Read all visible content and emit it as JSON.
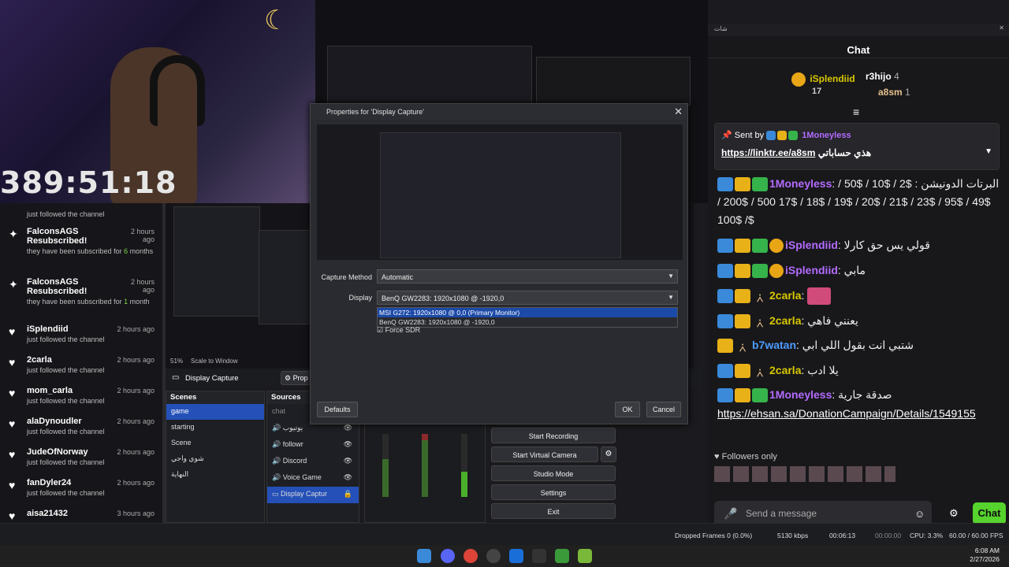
{
  "timer": "389:51:18",
  "events": [
    {
      "name": "",
      "desc": "just followed the channel",
      "time": "2 hours ago",
      "icon": "heart-icon"
    },
    {
      "name": "FalconsAGS Resubscribed!",
      "desc_pre": "they have been subscribed for ",
      "desc_hl": "6",
      "desc_post": " months",
      "time": "2 hours ago",
      "icon": "star-icon"
    },
    {
      "name": "FalconsAGS Resubscribed!",
      "desc_pre": "they have been subscribed for ",
      "desc_hl": "1",
      "desc_post": " month",
      "time": "2 hours ago",
      "icon": "star-icon"
    },
    {
      "name": "iSplendiid",
      "desc": "just followed the channel",
      "time": "2 hours ago",
      "icon": "heart-icon"
    },
    {
      "name": "2carla",
      "desc": "just followed the channel",
      "time": "2 hours ago",
      "icon": "heart-icon"
    },
    {
      "name": "mom_carla",
      "desc": "just followed the channel",
      "time": "2 hours ago",
      "icon": "heart-icon"
    },
    {
      "name": "alaDynoudler",
      "desc": "just followed the channel",
      "time": "2 hours ago",
      "icon": "heart-icon"
    },
    {
      "name": "JudeOfNorway",
      "desc": "just followed the channel",
      "time": "2 hours ago",
      "icon": "heart-icon"
    },
    {
      "name": "fanDyler24",
      "desc": "just followed the channel",
      "time": "2 hours ago",
      "icon": "heart-icon"
    },
    {
      "name": "aisa21432",
      "desc": "",
      "time": "3 hours ago",
      "icon": "heart-icon"
    }
  ],
  "dialog": {
    "title": "Properties for 'Display Capture'",
    "capture_method_label": "Capture Method",
    "capture_method_value": "Automatic",
    "display_label": "Display",
    "display_value": "BenQ GW2283: 1920x1080 @ -1920,0",
    "options": [
      "MSI G272: 1920x1080 @ 0,0 (Primary Monitor)",
      "BenQ GW2283: 1920x1080 @ -1920,0"
    ],
    "force_sdr": "Force SDR",
    "defaults": "Defaults",
    "ok": "OK",
    "cancel": "Cancel"
  },
  "obs": {
    "zoom": "51%",
    "scale": "Scale to Window",
    "source_name": "Display Capture",
    "properties": "Prop",
    "scenes_title": "Scenes",
    "scenes": [
      "game",
      "starting",
      "Scene",
      "شوي واجي",
      "النهاية"
    ],
    "sources_title": "Sources",
    "sources": [
      "chat",
      "يوتيوب",
      "followr",
      "Discord",
      "Voice Game",
      "Display Captur"
    ],
    "controls": [
      "Start Recording",
      "Start Virtual Camera",
      "Studio Mode",
      "Settings",
      "Exit"
    ]
  },
  "status": {
    "dropped": "Dropped Frames 0 (0.0%)",
    "kbps": "5130 kbps",
    "live": "00:06:13",
    "rec": "00:00:00",
    "cpu": "CPU: 3.3%",
    "fps": "60.00 / 60.00 FPS"
  },
  "clock": {
    "time": "6:08 AM",
    "date": "2/27/2026"
  },
  "chat": {
    "window_title": "شات",
    "header": "Chat",
    "leaders": [
      {
        "name": "iSplendiid",
        "count": "17"
      },
      {
        "name": "r3hijo",
        "count": "4"
      },
      {
        "name": "a8sm",
        "count": "1"
      }
    ],
    "pin_sent_by": "Sent by",
    "pin_user": "1Moneyless",
    "pin_link": "https://linktr.ee/a8sm",
    "pin_text": "هذي حساباتي",
    "messages": [
      {
        "user": "1Moneyless",
        "text": ": البرتات الدونيشن : $2 / $10 / $50 / $49 / $95 / $23 / $21 / $20 / $19 / $18 / $17 500 / $200 / $100 /$"
      },
      {
        "user": "iSplendiid",
        "text": ": قولي يس حق كارلا"
      },
      {
        "user": "iSplendiid",
        "text": ": مابي"
      },
      {
        "user": "2carla",
        "text": ":"
      },
      {
        "user": "2carla",
        "text": ": يعنني فاهي"
      },
      {
        "user": "b7watan",
        "text": ": شتبي انت بقول اللي ابي"
      },
      {
        "user": "2carla",
        "text": ": يلا ادب"
      },
      {
        "user": "1Moneyless",
        "text": ": صدقة جارية"
      }
    ],
    "donation_link": "https://ehsan.sa/DonationCampaign/Details/1549155",
    "followers_only": "Followers only",
    "send_placeholder": "Send a message",
    "chat_button": "Chat"
  }
}
